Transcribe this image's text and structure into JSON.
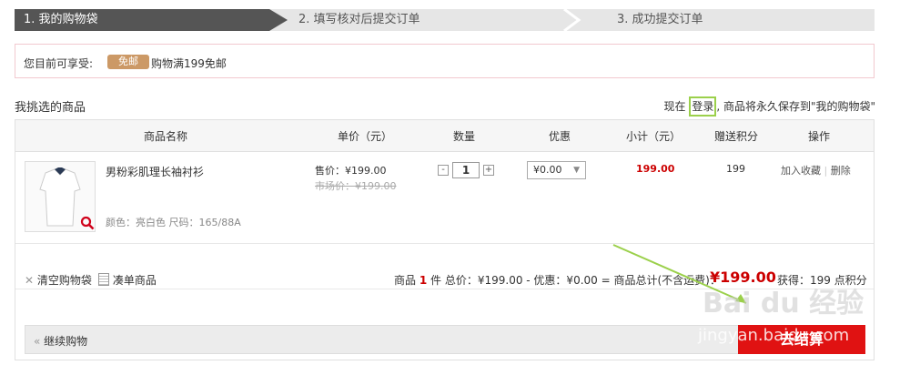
{
  "steps": [
    {
      "label": "1. 我的购物袋",
      "active": true
    },
    {
      "label": "2. 填写核对后提交订单",
      "active": false
    },
    {
      "label": "3. 成功提交订单",
      "active": false
    }
  ],
  "promo": {
    "label": "您目前可享受:",
    "tag": "免邮",
    "text": "购物满199免邮"
  },
  "section": {
    "title": "我挑选的商品",
    "login_prefix": "现在",
    "login_link": "登录",
    "login_suffix": ", 商品将永久保存到\"我的购物袋\""
  },
  "table": {
    "headers": [
      "商品名称",
      "单价（元）",
      "数量",
      "优惠",
      "小计（元）",
      "赠送积分",
      "操作"
    ]
  },
  "item": {
    "name": "男粉彩肌理长袖衬衫",
    "attrs": "颜色：亮白色 尺码：165/88A",
    "price_label": "售价：¥199.00",
    "market_price": "市场价：¥199.00",
    "qty_minus": "-",
    "qty": "1",
    "qty_plus": "+",
    "discount": "¥0.00",
    "subtotal": "199.00",
    "points": "199",
    "action_fav": "加入收藏",
    "action_sep": "|",
    "action_del": "删除"
  },
  "footer": {
    "clear": "清空购物袋",
    "bundle": "凑单商品",
    "summary_prefix": "商品",
    "count": "1",
    "summary_mid": "件 总价：¥199.00 - 优惠：¥0.00 = 商品总计(不含运费)：",
    "total": "¥199.00",
    "points_label": "获得：199 点积分"
  },
  "bottom": {
    "continue": "继续购物",
    "checkout": "去结算"
  },
  "watermark": {
    "line1": "Bai du 经验",
    "line2": "jingyan.baidu.com"
  },
  "colors": {
    "accent_red": "#e01212",
    "price_red": "#cc0000",
    "promo_tag": "#cc9966",
    "login_highlight": "#9bd04b"
  }
}
